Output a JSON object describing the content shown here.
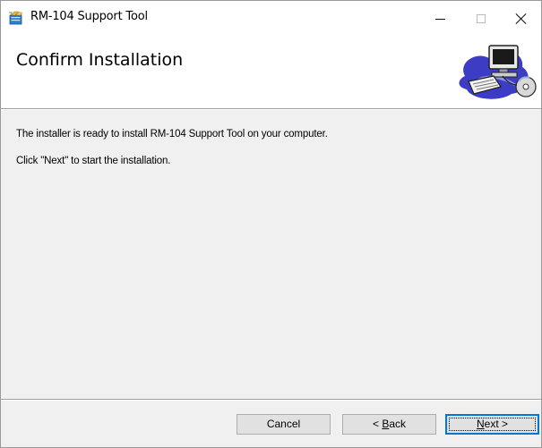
{
  "window": {
    "title": "RM-104 Support Tool",
    "app_icon": "installer-box-icon",
    "controls": [
      "minimize-icon",
      "maximize-icon",
      "close-icon"
    ]
  },
  "banner": {
    "title": "Confirm Installation",
    "art": "computer-with-cd-icon"
  },
  "body": {
    "line1": "The installer is ready to install RM-104 Support Tool on your computer.",
    "line2": "Click \"Next\" to start the installation."
  },
  "buttons": {
    "cancel": "Cancel",
    "back_prefix": "< ",
    "back_mnemonic": "B",
    "back_rest": "ack",
    "next_mnemonic": "N",
    "next_rest": "ext >"
  },
  "colors": {
    "focus_border": "#0078d7",
    "dialog_bg": "#f0f0f0"
  }
}
